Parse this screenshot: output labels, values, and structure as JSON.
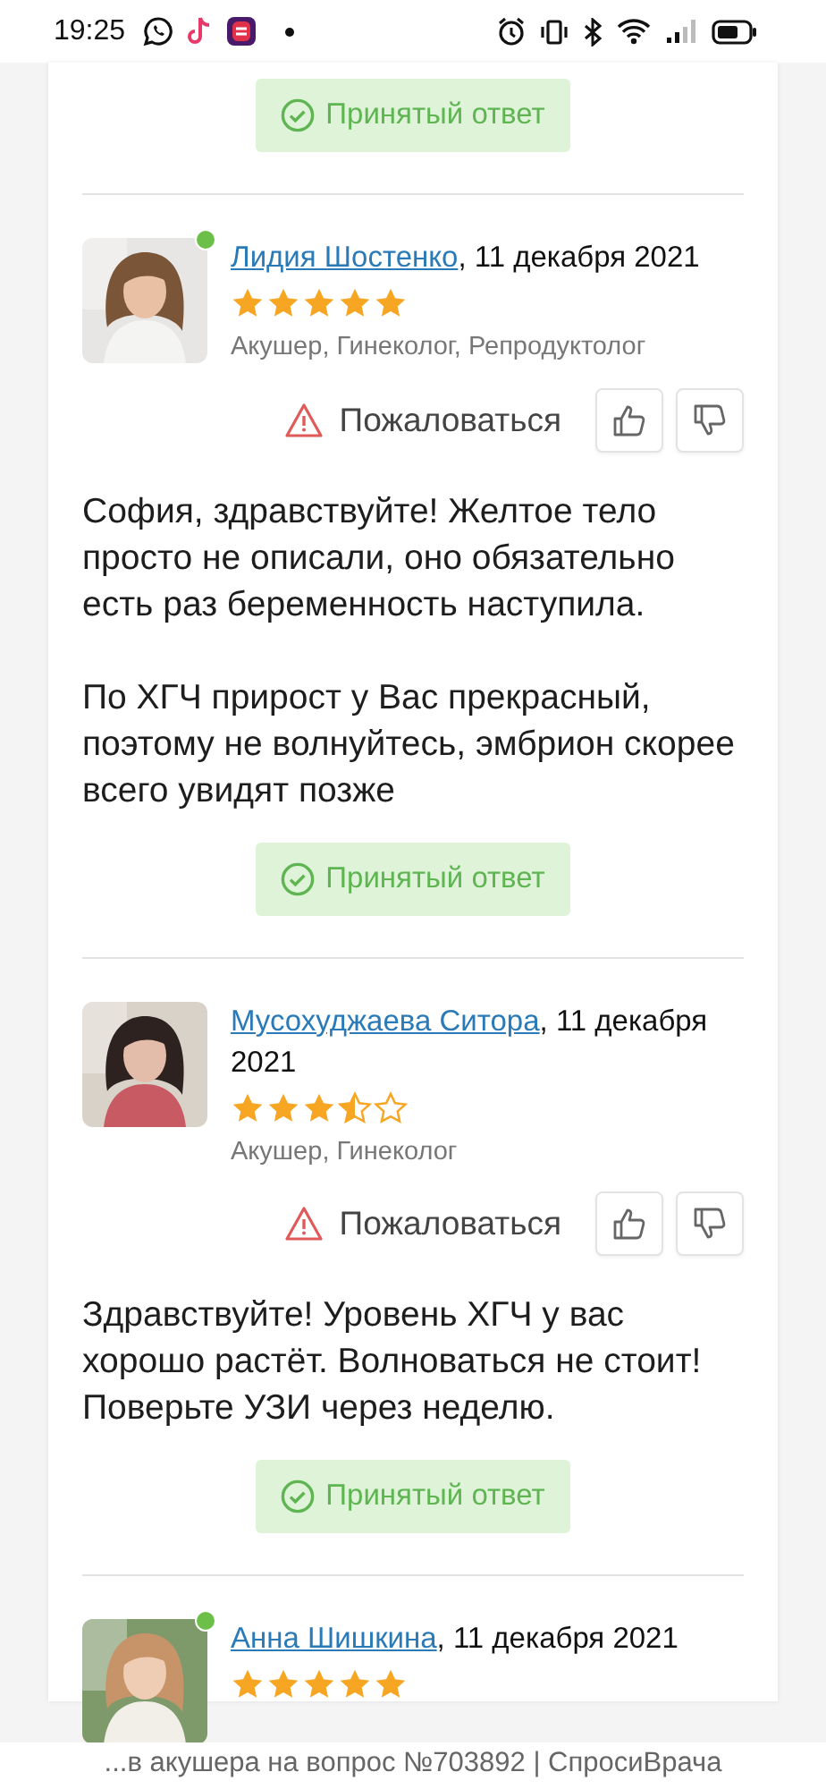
{
  "status_bar": {
    "time": "19:25"
  },
  "previous_answer": {
    "accepted_label": "Принятый ответ"
  },
  "answers": [
    {
      "author": "Лидия Шостенко",
      "date": ", 11 декабря 2021",
      "online": true,
      "stars": 5,
      "specialty": "Акушер, Гинеколог, Репродуктолог",
      "report": "Пожаловаться",
      "paragraphs": [
        "София, здравствуйте! Желтое тело просто не описали, оно обязательно есть раз беременность наступила.",
        "По ХГЧ прирост у Вас прекрасный, поэтому не волнуйтесь, эмбрион скорее всего увидят позже"
      ],
      "accepted_label": "Принятый ответ"
    },
    {
      "author": "Мусохуджаева Ситора",
      "date": ", 11 декабря 2021",
      "online": false,
      "stars": 3.5,
      "specialty": "Акушер, Гинеколог",
      "report": "Пожаловаться",
      "paragraphs": [
        "Здравствуйте! Уровень ХГЧ у вас хорошо растёт. Волноваться не стоит! Поверьте УЗИ через неделю."
      ],
      "accepted_label": "Принятый ответ"
    },
    {
      "author": "Анна Шишкина",
      "date": ", 11 декабря 2021",
      "online": true,
      "stars": 5
    }
  ],
  "page_title": "...в акушера на вопрос №703892 | СпросиВрача"
}
